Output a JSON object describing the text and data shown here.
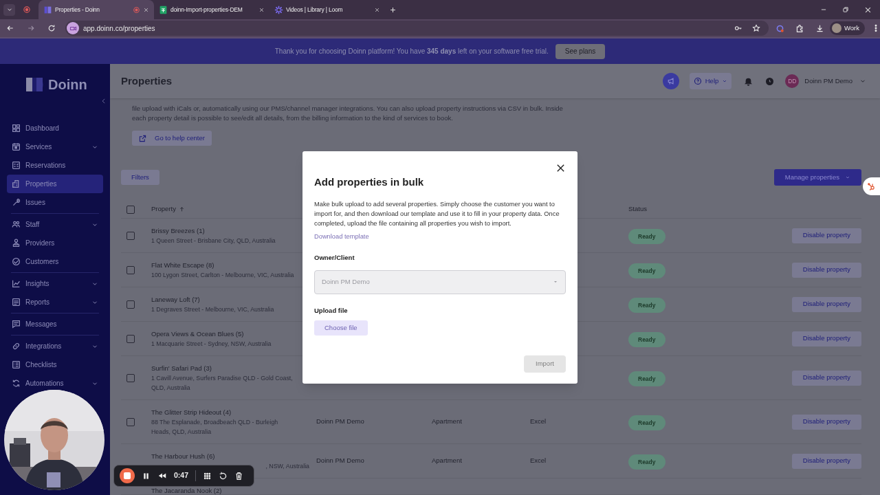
{
  "browser": {
    "tabs": [
      {
        "title": "Properties - Doinn",
        "selected": true,
        "recording": true
      },
      {
        "title": "doinn-Import-properties-DEM",
        "selected": false,
        "recording": false
      },
      {
        "title": "Videos | Library | Loom",
        "selected": false,
        "recording": false
      }
    ],
    "address": "app.doinn.co/properties",
    "profile": "Work"
  },
  "banner": {
    "message": "Thank you for choosing Doinn platform! You have **345 days** left on your software free trial.",
    "button": "See plans"
  },
  "sidebar": {
    "logo": "Doinn",
    "groups": [
      [
        {
          "label": "Dashboard",
          "expandable": false,
          "selected": false
        },
        {
          "label": "Services",
          "expandable": true,
          "selected": false
        },
        {
          "label": "Reservations",
          "expandable": false,
          "selected": false
        },
        {
          "label": "Properties",
          "expandable": false,
          "selected": true
        },
        {
          "label": "Issues",
          "expandable": false,
          "selected": false
        }
      ],
      [
        {
          "label": "Staff",
          "expandable": true,
          "selected": false
        },
        {
          "label": "Providers",
          "expandable": false,
          "selected": false
        },
        {
          "label": "Customers",
          "expandable": false,
          "selected": false
        }
      ],
      [
        {
          "label": "Insights",
          "expandable": true,
          "selected": false
        },
        {
          "label": "Reports",
          "expandable": true,
          "selected": false
        }
      ],
      [
        {
          "label": "Messages",
          "expandable": false,
          "selected": false
        }
      ],
      [
        {
          "label": "Integrations",
          "expandable": true,
          "selected": false
        },
        {
          "label": "Checklists",
          "expandable": false,
          "selected": false
        },
        {
          "label": "Automations",
          "expandable": true,
          "selected": false
        }
      ]
    ]
  },
  "header": {
    "title": "Properties",
    "help": "Help",
    "avatar": "DD",
    "user": "Doinn PM Demo"
  },
  "intro": {
    "lines": [
      "file upload with iCals or, automatically using our PMS/channel manager integrations. You can also upload property instructions via CSV in bulk. Inside",
      "each property detail is possible to see/edit all details, from the billing information to the kind of services to book."
    ],
    "help_link": "Go to help center"
  },
  "toolbar": {
    "filters": "Filters",
    "manage": "Manage properties"
  },
  "table": {
    "all_checked": false,
    "columns": [
      {
        "label": "Property",
        "sorted": true
      },
      {
        "label": "Status"
      }
    ],
    "rows": [
      {
        "name": "Brissy Breezes (1)",
        "address": "1 Queen Street - Brisbane City, QLD, Australia",
        "status": "Ready",
        "action": "Disable property",
        "checked": false
      },
      {
        "name": "Flat White Escape (8)",
        "address": "100 Lygon Street, Carlton - Melbourne, VIC, Australia",
        "status": "Ready",
        "action": "Disable property",
        "checked": false
      },
      {
        "name": "Laneway Loft (7)",
        "address": "1 Degraves Street - Melbourne, VIC, Australia",
        "status": "Ready",
        "action": "Disable property",
        "checked": false
      },
      {
        "name": "Opera Views & Ocean Blues (5)",
        "address": "1 Macquarie Street - Sydney, NSW, Australia",
        "status": "Ready",
        "action": "Disable property",
        "checked": false
      },
      {
        "name": "Surfin' Safari Pad (3)",
        "address": "1 Cavill Avenue, Surfers Paradise QLD - Gold Coast, QLD, Australia",
        "status": "Ready",
        "action": "Disable property",
        "checked": false
      },
      {
        "name": "The Glitter Strip Hideout (4)",
        "address": "88 The Esplanade, Broadbeach QLD - Burleigh Heads, QLD, Australia",
        "owner": "Doinn PM Demo",
        "type": "Apartment",
        "source": "Excel",
        "status": "Ready",
        "action": "Disable property",
        "checked": false
      },
      {
        "name": "The Harbour Hush (6)",
        "address": ", NSW, Australia",
        "address_clipped": true,
        "owner": "Doinn PM Demo",
        "type": "Apartment",
        "source": "Excel",
        "status": "Ready",
        "action": "Disable property"
      },
      {
        "name": "The Jacaranda Nook (2)"
      }
    ]
  },
  "modal": {
    "title": "Add properties in bulk",
    "description": "Make bulk upload to add several properties. Simply choose the customer you want to import for, and then download our template and use it to fill in your property data. Once completed, upload the file containing all properties you wish to import.",
    "template_link": "Download template",
    "owner_label": "Owner/Client",
    "owner_value": "Doinn PM Demo",
    "owner_disabled": true,
    "upload_label": "Upload file",
    "choose_file": "Choose file",
    "import": "Import",
    "import_disabled": true
  },
  "recorder": {
    "time": "0:47"
  }
}
